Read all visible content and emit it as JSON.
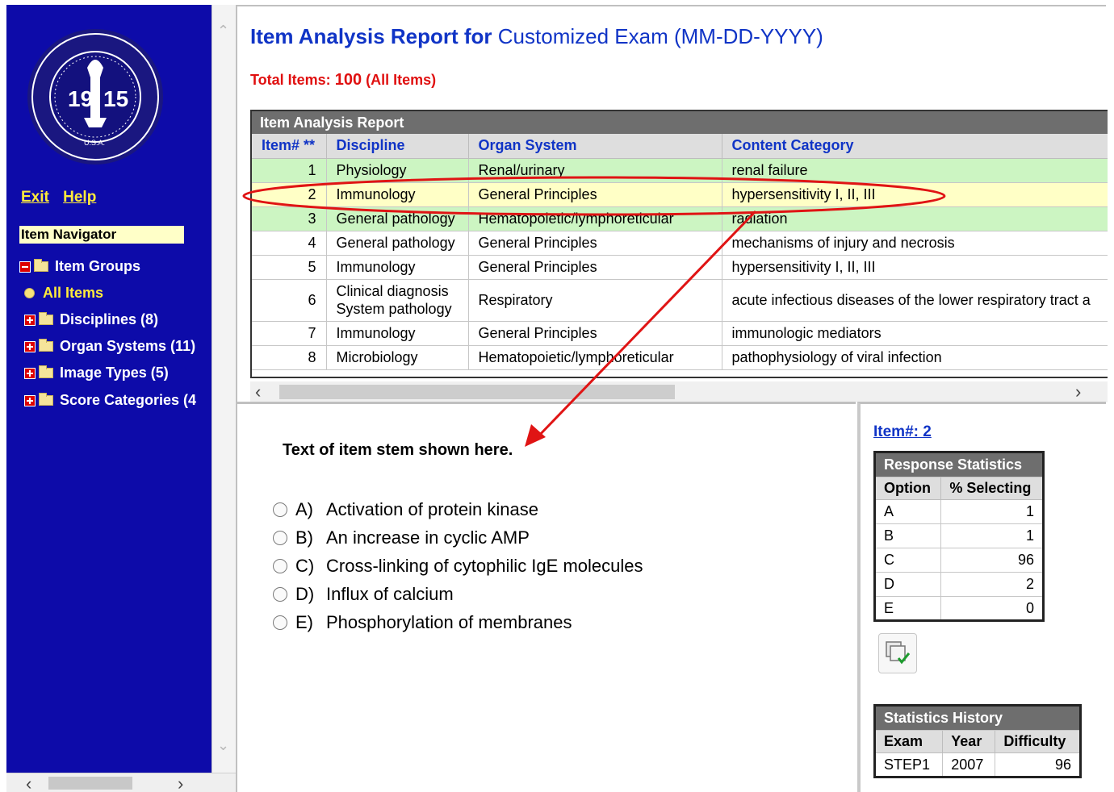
{
  "sidebar": {
    "seal_text": {
      "year_left": "19",
      "year_right": "15",
      "ring": "NATIONAL BOARD OF MEDICAL EXAMINERS",
      "country": "U.S.A."
    },
    "links": {
      "exit": "Exit",
      "help": "Help"
    },
    "navigator_title": "Item Navigator",
    "tree": {
      "item_groups": "Item Groups",
      "all_items": "All Items",
      "disciplines": "Disciplines (8)",
      "organ_systems": "Organ Systems (11)",
      "image_types": "Image Types (5)",
      "score_categories": "Score Categories (4"
    }
  },
  "header": {
    "title_bold": "Item Analysis Report for",
    "title_rest": "Customized Exam (MM-DD-YYYY)",
    "total_label": "Total Items:",
    "total_count": "100",
    "total_note": "(All Items)"
  },
  "report": {
    "caption": "Item Analysis Report",
    "columns": [
      "Item# **",
      "Discipline",
      "Organ System",
      "Content Category"
    ],
    "rows": [
      {
        "item": "1",
        "discipline": "Physiology",
        "organ": "Renal/urinary",
        "category": "renal failure",
        "highlight": "green"
      },
      {
        "item": "2",
        "discipline": "Immunology",
        "organ": "General Principles",
        "category": "hypersensitivity I, II, III",
        "highlight": "yellow"
      },
      {
        "item": "3",
        "discipline": "General pathology",
        "organ": "Hematopoietic/lymphoreticular",
        "category": "radiation",
        "highlight": "green"
      },
      {
        "item": "4",
        "discipline": "General pathology",
        "organ": "General Principles",
        "category": "mechanisms of injury and necrosis",
        "highlight": "none"
      },
      {
        "item": "5",
        "discipline": "Immunology",
        "organ": "General Principles",
        "category": "hypersensitivity I, II, III",
        "highlight": "none"
      },
      {
        "item": "6",
        "discipline": "Clinical diagnosis System pathology",
        "organ": "Respiratory",
        "category": "acute infectious diseases of the lower respiratory tract a",
        "highlight": "none"
      },
      {
        "item": "7",
        "discipline": "Immunology",
        "organ": "General Principles",
        "category": "immunologic mediators",
        "highlight": "none"
      },
      {
        "item": "8",
        "discipline": "Microbiology",
        "organ": "Hematopoietic/lymphoreticular",
        "category": "pathophysiology of viral infection",
        "highlight": "none"
      }
    ]
  },
  "item": {
    "stem": "Text of item stem shown here.",
    "options": [
      {
        "letter": "A)",
        "text": "Activation of protein kinase"
      },
      {
        "letter": "B)",
        "text": "An increase in cyclic AMP"
      },
      {
        "letter": "C)",
        "text": "Cross-linking of cytophilic IgE molecules"
      },
      {
        "letter": "D)",
        "text": "Influx of calcium"
      },
      {
        "letter": "E)",
        "text": "Phosphorylation of membranes"
      }
    ]
  },
  "stats": {
    "item_link": "Item#: 2",
    "response": {
      "caption": "Response Statistics",
      "columns": [
        "Option",
        "% Selecting"
      ],
      "rows": [
        {
          "option": "A",
          "pct": "1"
        },
        {
          "option": "B",
          "pct": "1"
        },
        {
          "option": "C",
          "pct": "96"
        },
        {
          "option": "D",
          "pct": "2"
        },
        {
          "option": "E",
          "pct": "0"
        }
      ]
    },
    "history": {
      "caption": "Statistics History",
      "columns": [
        "Exam",
        "Year",
        "Difficulty"
      ],
      "rows": [
        {
          "exam": "STEP1",
          "year": "2007",
          "difficulty": "96"
        }
      ]
    }
  },
  "icons": [
    "seal-logo",
    "minus-expander-icon",
    "plus-expander-icon",
    "folder-icon",
    "open-folder-icon",
    "bullet-icon",
    "radio-icon",
    "copy-check-icon",
    "chevron-up-icon",
    "chevron-down-icon",
    "chevron-left-icon",
    "chevron-right-icon"
  ],
  "colors": {
    "sidebar_bg": "#0d0ba9",
    "link": "#ffeb3b",
    "title_blue": "#1034c6",
    "total_red": "#e01010",
    "row_green": "#ccf5c2",
    "row_yellow": "#ffffc6",
    "annotation_red": "#e01414"
  }
}
